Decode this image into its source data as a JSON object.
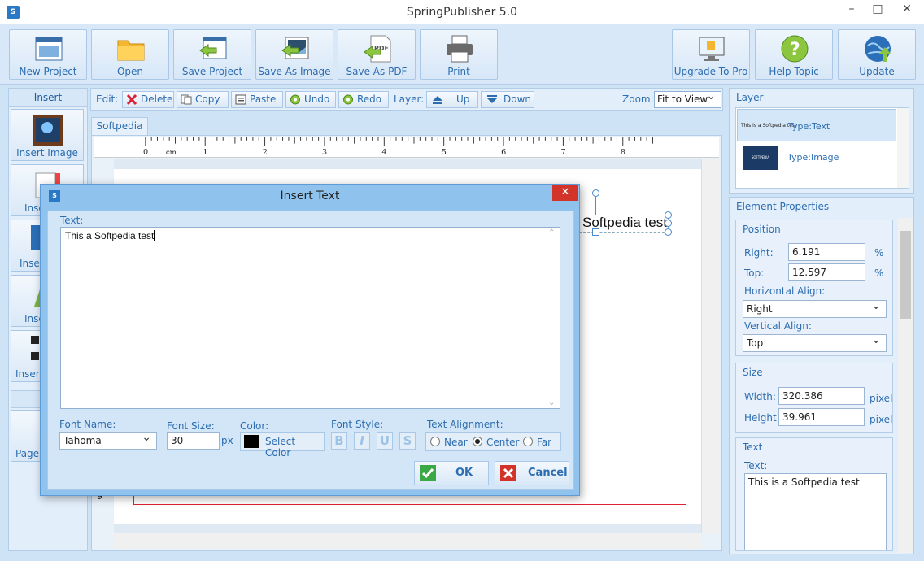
{
  "window": {
    "title": "SpringPublisher 5.0",
    "icon_text": "S"
  },
  "toolbar": {
    "new_project": "New Project",
    "open": "Open",
    "save_project": "Save Project",
    "save_as_image": "Save As Image",
    "save_as_pdf": "Save As PDF",
    "print": "Print",
    "upgrade": "Upgrade To Pro",
    "help": "Help Topic",
    "update": "Update",
    "pdf_badge": "PDF"
  },
  "insert_panel": {
    "header": "Insert",
    "items": [
      "Insert Image",
      "Inse",
      "Inser",
      "Inse",
      "Insert"
    ],
    "sub_header": "F",
    "page_item": "Page"
  },
  "editbar": {
    "edit_label": "Edit:",
    "delete": "Delete",
    "copy": "Copy",
    "paste": "Paste",
    "undo": "Undo",
    "redo": "Redo",
    "layer_label": "Layer:",
    "up": "Up",
    "down": "Down",
    "zoom_label": "Zoom:",
    "zoom_value": "Fit to View"
  },
  "document": {
    "tab": "Softpedia",
    "ruler_unit": "cm",
    "ruler_numbers": [
      "0",
      "1",
      "2",
      "3",
      "4",
      "5",
      "6",
      "7",
      "8"
    ],
    "selected_text": "Softpedia test",
    "side_marker": "9"
  },
  "layer_panel": {
    "header": "Layer",
    "rows": [
      {
        "thumb": "This is a Softpedia test",
        "type": "Type:Text"
      },
      {
        "thumb": "SOFTPEDIA",
        "type": "Type:Image"
      }
    ]
  },
  "element_properties": {
    "header": "Element Properties",
    "position": {
      "title": "Position",
      "right_label": "Right:",
      "right_value": "6.191",
      "right_unit": "%",
      "top_label": "Top:",
      "top_value": "12.597",
      "top_unit": "%",
      "halign_label": "Horizontal Align:",
      "halign_value": "Right",
      "valign_label": "Vertical Align:",
      "valign_value": "Top"
    },
    "size": {
      "title": "Size",
      "width_label": "Width:",
      "width_value": "320.386",
      "width_unit": "pixel",
      "height_label": "Height:",
      "height_value": "39.961",
      "height_unit": "pixel"
    },
    "text": {
      "title": "Text",
      "text_label": "Text:",
      "text_value": "This is a Softpedia test"
    }
  },
  "dialog": {
    "title": "Insert Text",
    "icon_text": "S",
    "text_label": "Text:",
    "text_value": "This a Softpedia test",
    "font_name_label": "Font Name:",
    "font_name_value": "Tahoma",
    "font_size_label": "Font Size:",
    "font_size_value": "30",
    "font_size_unit": "px",
    "color_label": "Color:",
    "select_color": "Select Color",
    "font_style_label": "Font Style:",
    "bold": "B",
    "italic": "I",
    "underline": "U",
    "strike": "S",
    "alignment_label": "Text Alignment:",
    "near": "Near",
    "center": "Center",
    "far": "Far",
    "ok": "OK",
    "cancel": "Cancel"
  },
  "colors": {
    "accent": "#2c6db0",
    "close_red": "#d2342a",
    "page_border": "#dd2233",
    "ok_green": "#3aa844"
  }
}
